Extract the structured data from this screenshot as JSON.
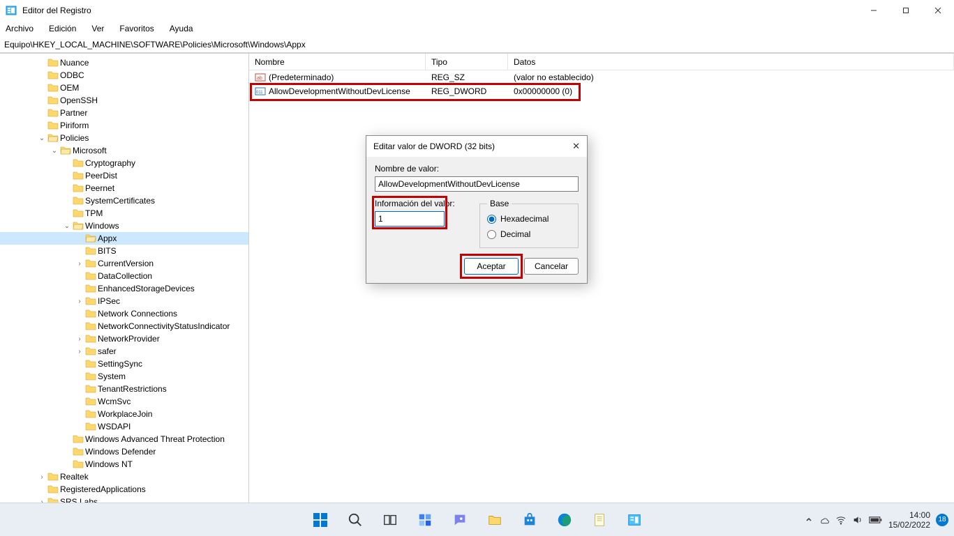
{
  "window": {
    "title": "Editor del Registro",
    "menu": [
      "Archivo",
      "Edición",
      "Ver",
      "Favoritos",
      "Ayuda"
    ],
    "address": "Equipo\\HKEY_LOCAL_MACHINE\\SOFTWARE\\Policies\\Microsoft\\Windows\\Appx"
  },
  "tree": [
    {
      "depth": 3,
      "chev": "",
      "label": "Nuance",
      "open": false
    },
    {
      "depth": 3,
      "chev": "",
      "label": "ODBC",
      "open": false
    },
    {
      "depth": 3,
      "chev": "",
      "label": "OEM",
      "open": false
    },
    {
      "depth": 3,
      "chev": "",
      "label": "OpenSSH",
      "open": false
    },
    {
      "depth": 3,
      "chev": "",
      "label": "Partner",
      "open": false
    },
    {
      "depth": 3,
      "chev": "",
      "label": "Piriform",
      "open": false
    },
    {
      "depth": 3,
      "chev": "v",
      "label": "Policies",
      "open": true
    },
    {
      "depth": 4,
      "chev": "v",
      "label": "Microsoft",
      "open": true
    },
    {
      "depth": 5,
      "chev": "",
      "label": "Cryptography",
      "open": false
    },
    {
      "depth": 5,
      "chev": "",
      "label": "PeerDist",
      "open": false
    },
    {
      "depth": 5,
      "chev": "",
      "label": "Peernet",
      "open": false
    },
    {
      "depth": 5,
      "chev": "",
      "label": "SystemCertificates",
      "open": false
    },
    {
      "depth": 5,
      "chev": "",
      "label": "TPM",
      "open": false
    },
    {
      "depth": 5,
      "chev": "v",
      "label": "Windows",
      "open": true
    },
    {
      "depth": 6,
      "chev": "",
      "label": "Appx",
      "open": true,
      "selected": true
    },
    {
      "depth": 6,
      "chev": "",
      "label": "BITS",
      "open": false
    },
    {
      "depth": 6,
      "chev": ">",
      "label": "CurrentVersion",
      "open": false
    },
    {
      "depth": 6,
      "chev": "",
      "label": "DataCollection",
      "open": false
    },
    {
      "depth": 6,
      "chev": "",
      "label": "EnhancedStorageDevices",
      "open": false
    },
    {
      "depth": 6,
      "chev": ">",
      "label": "IPSec",
      "open": false
    },
    {
      "depth": 6,
      "chev": "",
      "label": "Network Connections",
      "open": false
    },
    {
      "depth": 6,
      "chev": "",
      "label": "NetworkConnectivityStatusIndicator",
      "open": false
    },
    {
      "depth": 6,
      "chev": ">",
      "label": "NetworkProvider",
      "open": false
    },
    {
      "depth": 6,
      "chev": ">",
      "label": "safer",
      "open": false
    },
    {
      "depth": 6,
      "chev": "",
      "label": "SettingSync",
      "open": false
    },
    {
      "depth": 6,
      "chev": "",
      "label": "System",
      "open": false
    },
    {
      "depth": 6,
      "chev": "",
      "label": "TenantRestrictions",
      "open": false
    },
    {
      "depth": 6,
      "chev": "",
      "label": "WcmSvc",
      "open": false
    },
    {
      "depth": 6,
      "chev": "",
      "label": "WorkplaceJoin",
      "open": false
    },
    {
      "depth": 6,
      "chev": "",
      "label": "WSDAPI",
      "open": false
    },
    {
      "depth": 5,
      "chev": "",
      "label": "Windows Advanced Threat Protection",
      "open": false
    },
    {
      "depth": 5,
      "chev": "",
      "label": "Windows Defender",
      "open": false
    },
    {
      "depth": 5,
      "chev": "",
      "label": "Windows NT",
      "open": false
    },
    {
      "depth": 3,
      "chev": ">",
      "label": "Realtek",
      "open": false
    },
    {
      "depth": 3,
      "chev": "",
      "label": "RegisteredApplications",
      "open": false
    },
    {
      "depth": 3,
      "chev": ">",
      "label": "SRS Labs",
      "open": false
    }
  ],
  "list": {
    "headers": {
      "name": "Nombre",
      "type": "Tipo",
      "data": "Datos"
    },
    "rows": [
      {
        "icon": "sz",
        "name": "(Predeterminado)",
        "type": "REG_SZ",
        "data": "(valor no establecido)"
      },
      {
        "icon": "dword",
        "name": "AllowDevelopmentWithoutDevLicense",
        "type": "REG_DWORD",
        "data": "0x00000000 (0)"
      }
    ]
  },
  "dialog": {
    "title": "Editar valor de DWORD (32 bits)",
    "name_label": "Nombre de valor:",
    "name_value": "AllowDevelopmentWithoutDevLicense",
    "value_label": "Información del valor:",
    "value_value": "1",
    "base_label": "Base",
    "radio_hex": "Hexadecimal",
    "radio_dec": "Decimal",
    "ok": "Aceptar",
    "cancel": "Cancelar"
  },
  "taskbar": {
    "time": "14:00",
    "date": "15/02/2022"
  }
}
